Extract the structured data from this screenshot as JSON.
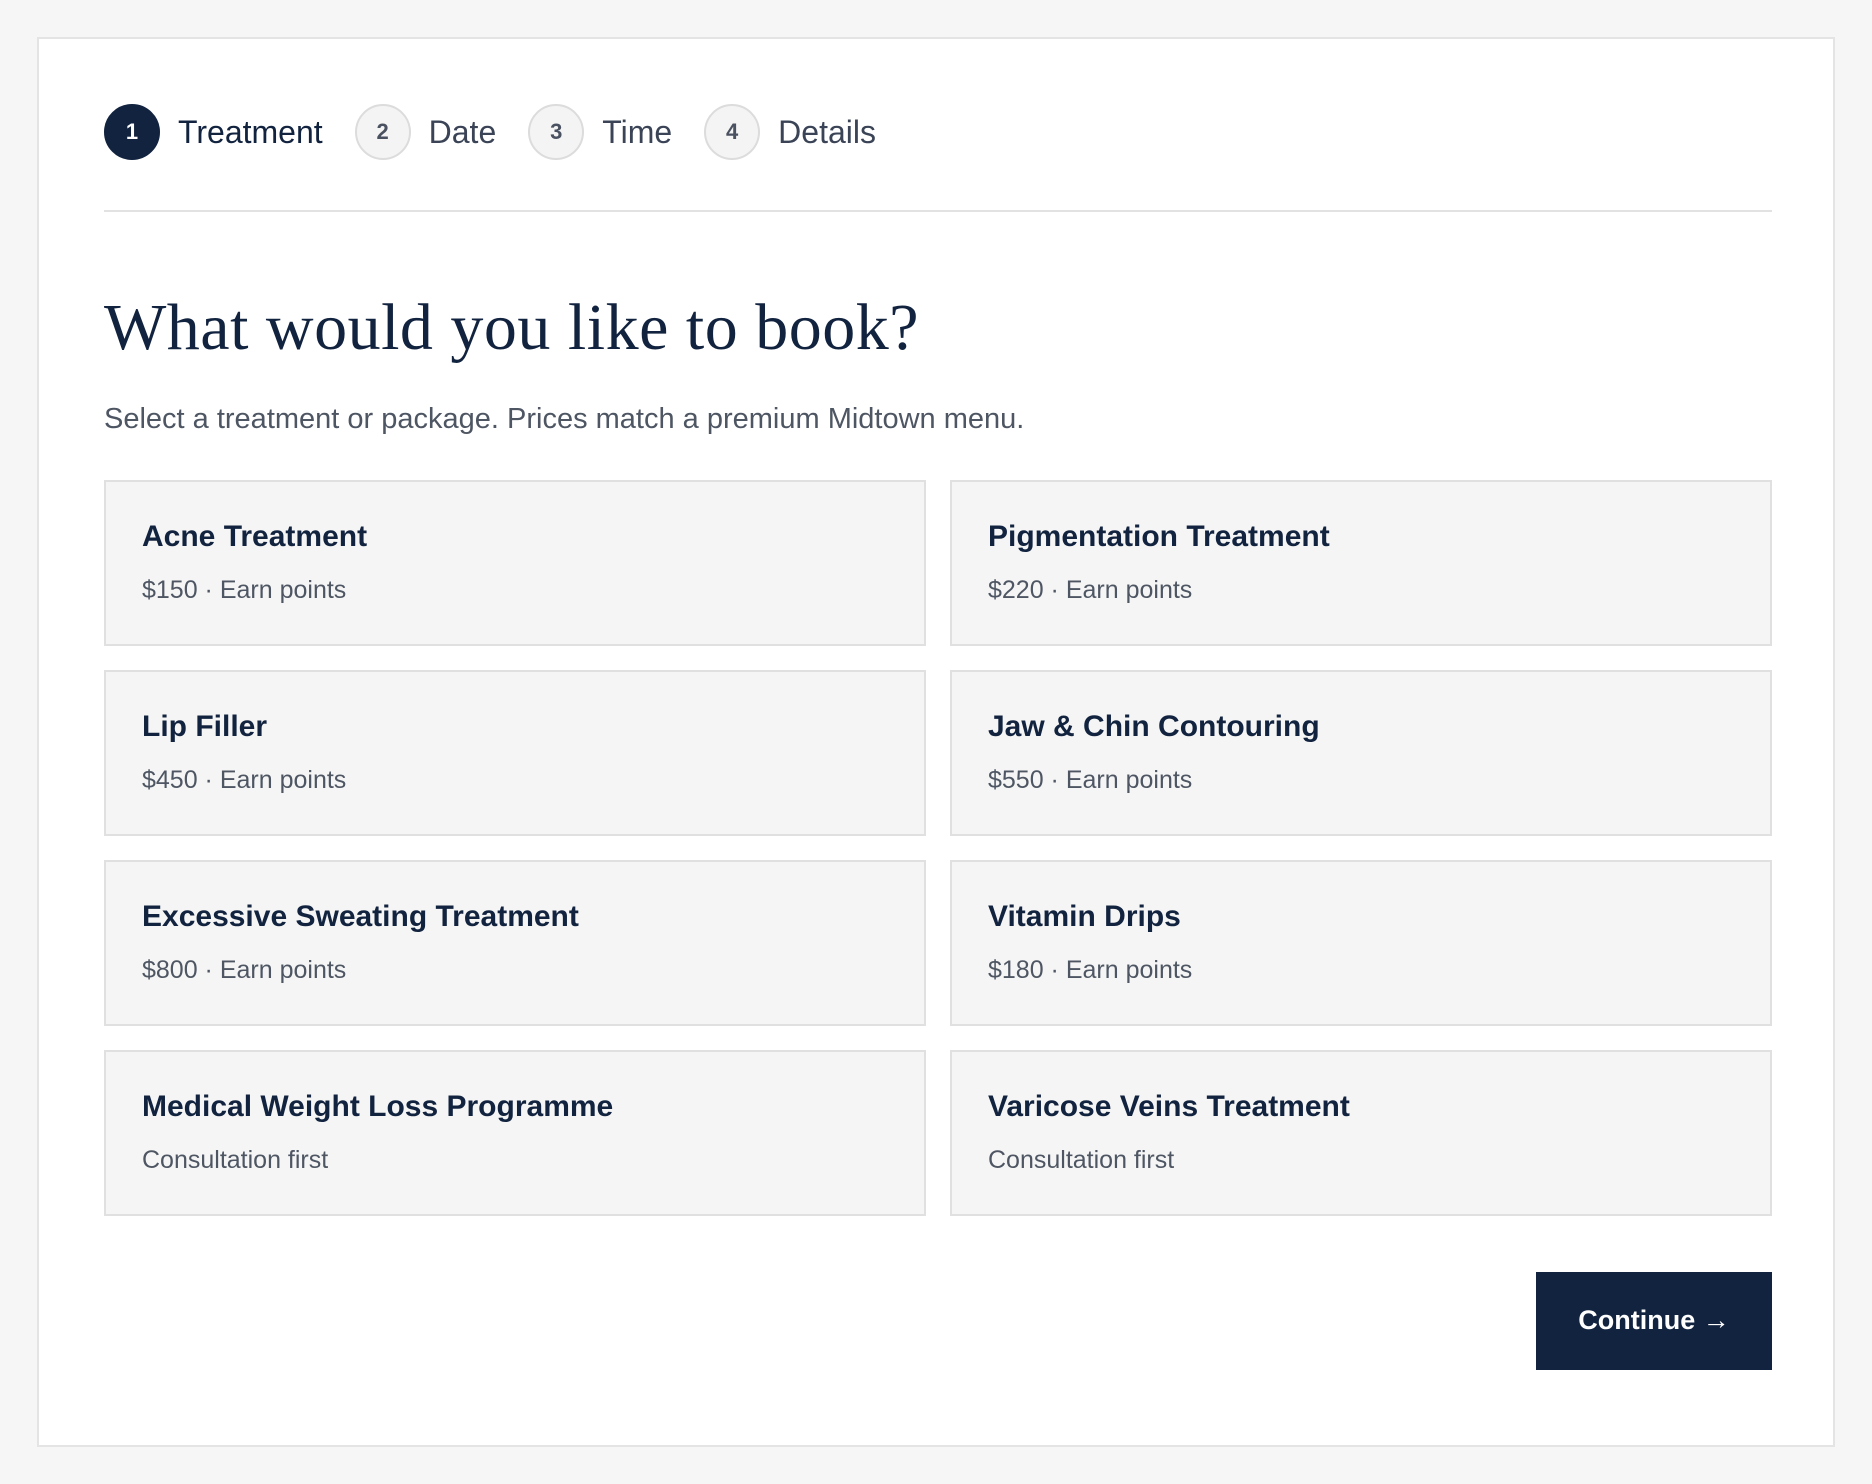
{
  "stepper": {
    "steps": [
      {
        "number": "1",
        "label": "Treatment",
        "active": true
      },
      {
        "number": "2",
        "label": "Date",
        "active": false
      },
      {
        "number": "3",
        "label": "Time",
        "active": false
      },
      {
        "number": "4",
        "label": "Details",
        "active": false
      }
    ]
  },
  "header": {
    "title": "What would you like to book?",
    "subtitle": "Select a treatment or package. Prices match a premium Midtown menu."
  },
  "options": [
    {
      "name": "Acne Treatment",
      "meta": "$150 · Earn points"
    },
    {
      "name": "Pigmentation Treatment",
      "meta": "$220 · Earn points"
    },
    {
      "name": "Lip Filler",
      "meta": "$450 · Earn points"
    },
    {
      "name": "Jaw & Chin Contouring",
      "meta": "$550 · Earn points"
    },
    {
      "name": "Excessive Sweating Treatment",
      "meta": "$800 · Earn points"
    },
    {
      "name": "Vitamin Drips",
      "meta": "$180 · Earn points"
    },
    {
      "name": "Medical Weight Loss Programme",
      "meta": "Consultation first"
    },
    {
      "name": "Varicose Veins Treatment",
      "meta": "Consultation first"
    }
  ],
  "footer": {
    "continue_label": "Continue →"
  },
  "colors": {
    "brand": "#12233f",
    "card_bg": "#f5f5f5",
    "page_bg": "#f6f6f6"
  }
}
